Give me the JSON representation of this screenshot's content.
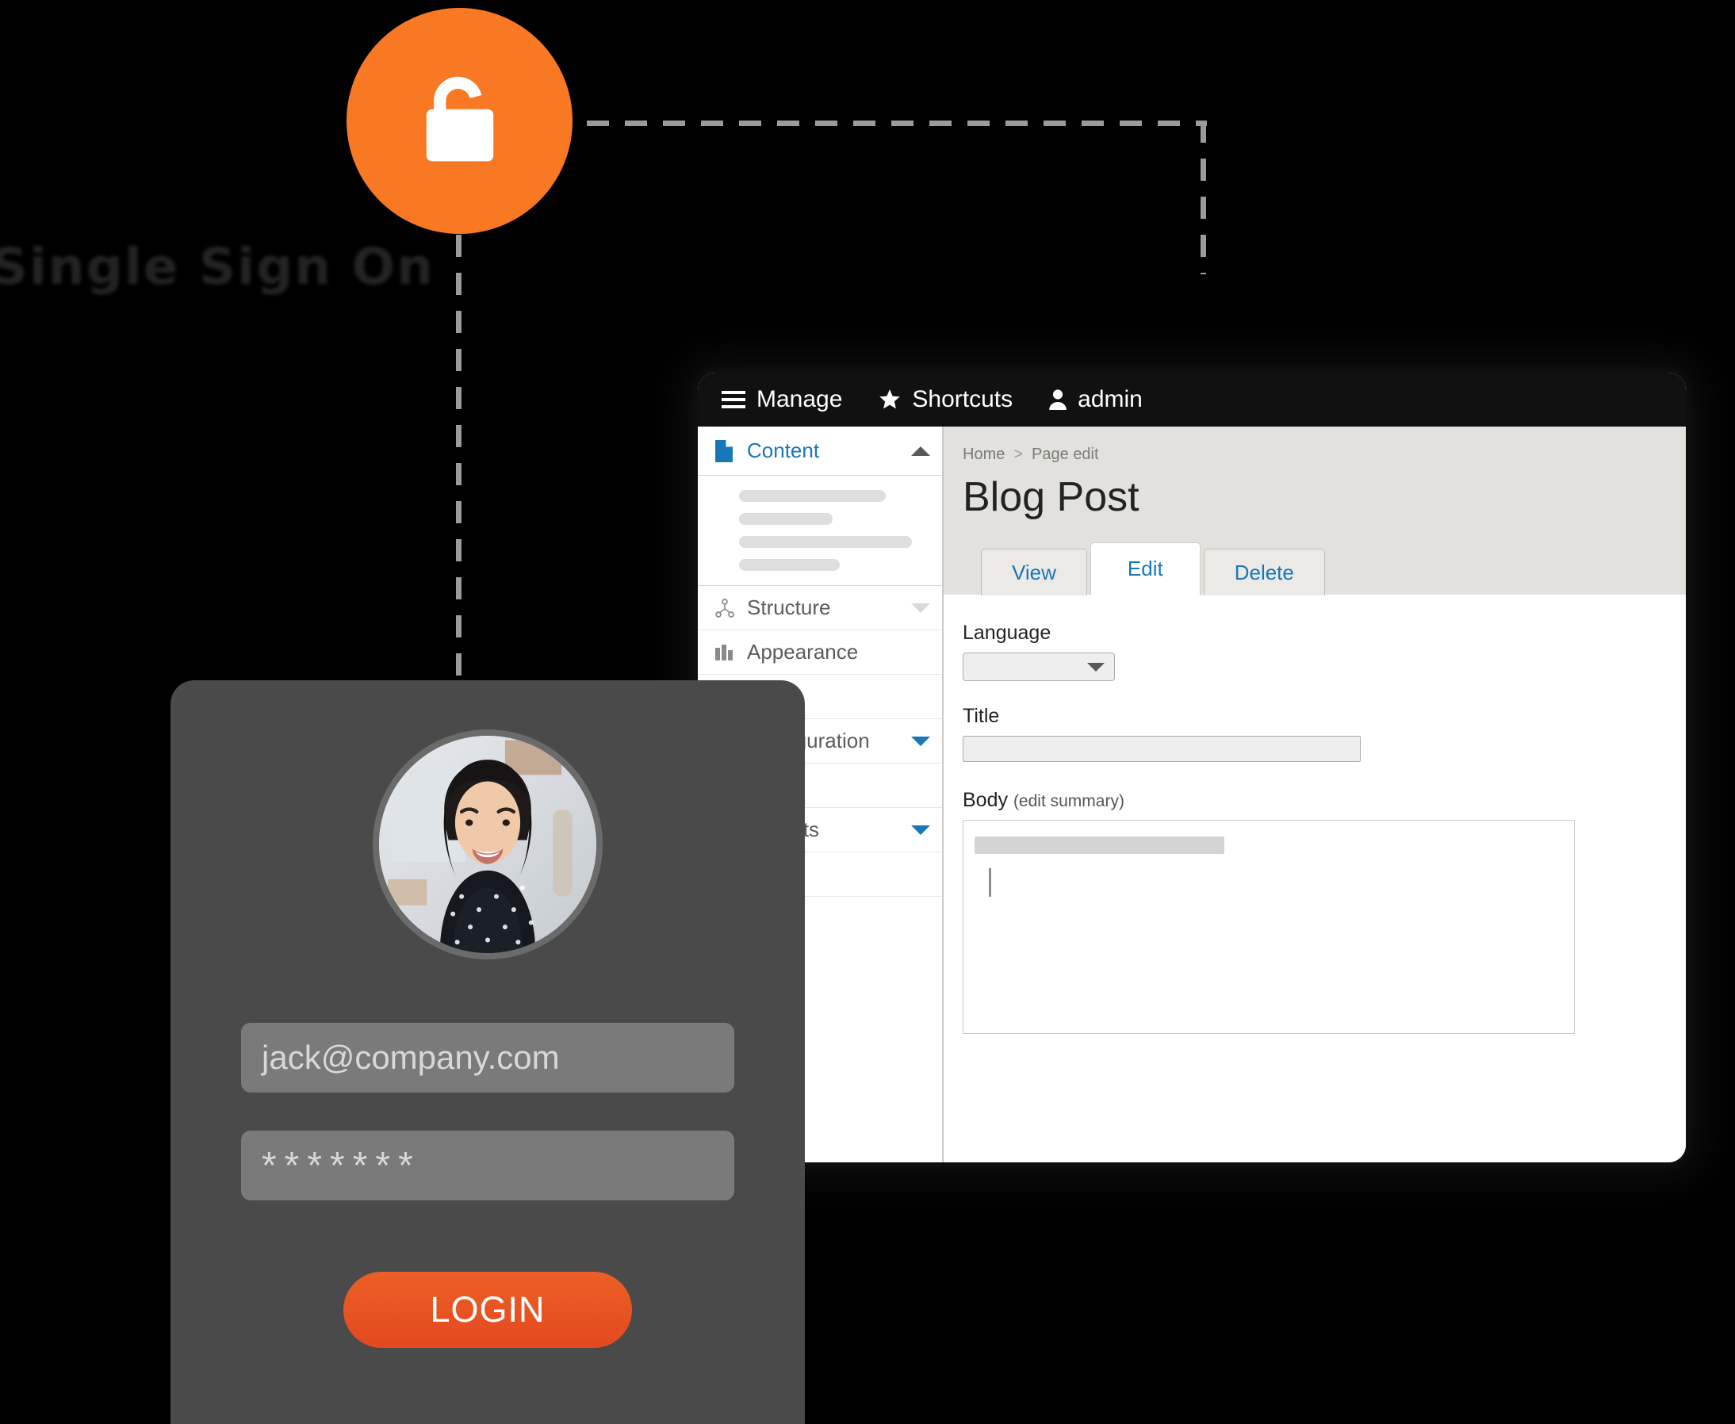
{
  "colors": {
    "brand_orange": "#f97824",
    "login_button": "#e4491f",
    "card_bg": "#4a4a4a",
    "toolbar_bg": "#111111",
    "link_blue": "#1877b8",
    "header_bg": "#e2e1dd",
    "page_bg": "#000000",
    "dash_line": "#9b9b9b"
  },
  "sso": {
    "badge_icon": "unlocked-padlock-icon",
    "label": "Single Sign On"
  },
  "browser": {
    "toolbar": [
      {
        "icon": "hamburger-menu-icon",
        "label": "Manage"
      },
      {
        "icon": "star-icon",
        "label": "Shortcuts"
      },
      {
        "icon": "person-icon",
        "label": "admin"
      }
    ],
    "sidebar": [
      {
        "icon": "document-icon",
        "label": "Content",
        "chevron": "chevron-up-icon",
        "active": true
      },
      {
        "icon": "structure-tree-icon",
        "label": "Structure",
        "chevron": "chevron-down-icon",
        "active": false
      },
      {
        "icon": "appearance-icon",
        "label": "Appearance",
        "chevron": "",
        "active": false
      },
      {
        "icon": "",
        "label": "Configuration",
        "chevron": "chevron-down-icon",
        "active": false
      },
      {
        "icon": "",
        "label": "Reports",
        "chevron": "chevron-down-icon",
        "active": false
      }
    ],
    "sidebar_skeleton_widths": [
      "185px",
      "118px",
      "218px",
      "127px"
    ],
    "main": {
      "breadcrumb": {
        "home": "Home",
        "separator": ">",
        "current": "Page edit"
      },
      "title": "Blog Post",
      "tabs": [
        {
          "label": "View",
          "active": false
        },
        {
          "label": "Edit",
          "active": true
        },
        {
          "label": "Delete",
          "active": false
        }
      ],
      "fields": {
        "language_label": "Language",
        "language_value": "",
        "language_chevron": "chevron-down-icon",
        "title_label": "Title",
        "title_value": "",
        "title_placeholder": "",
        "body_label": "Body",
        "body_label_suffix": "(edit summary)",
        "body_value": "",
        "body_placeholder": ""
      }
    }
  },
  "login": {
    "avatar_alt": "user-avatar-photo",
    "email_value": "jack@company.com",
    "email_placeholder": "jack@company.com",
    "password_value": "*******",
    "password_placeholder": "*******",
    "submit_label": "LOGIN"
  }
}
